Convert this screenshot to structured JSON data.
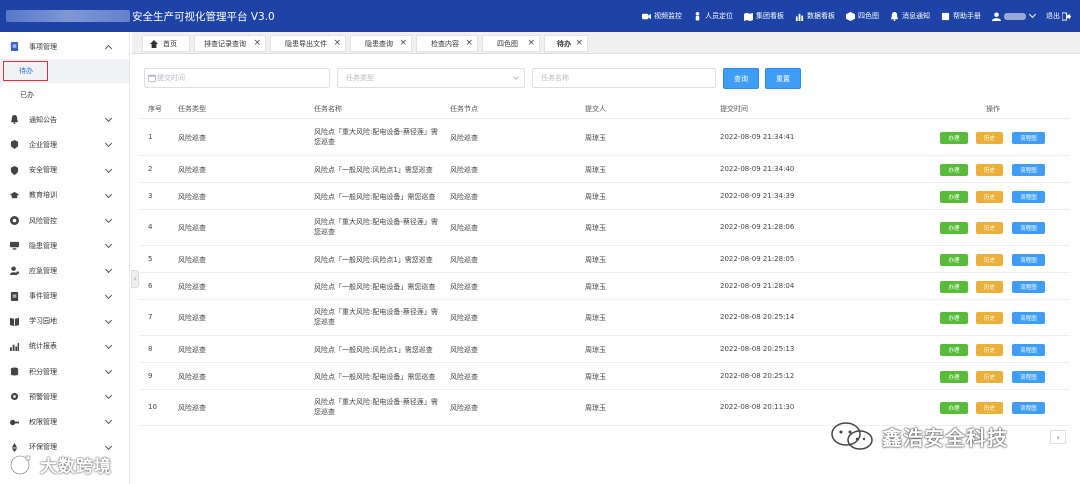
{
  "header": {
    "title": "安全生产可视化管理平台  V3.0",
    "menu": [
      {
        "label": "视频监控",
        "icon": "video-icon"
      },
      {
        "label": "人员定位",
        "icon": "person-pin-icon"
      },
      {
        "label": "集团看板",
        "icon": "map-icon"
      },
      {
        "label": "数据看板",
        "icon": "bar-chart-icon"
      },
      {
        "label": "四色图",
        "icon": "cube-icon"
      },
      {
        "label": "消息通知",
        "icon": "bell-icon"
      },
      {
        "label": "帮助手册",
        "icon": "book-icon"
      }
    ],
    "logout": "退出"
  },
  "sidebar": {
    "groups": [
      {
        "label": "事项管理",
        "icon": "task-icon",
        "expanded": true,
        "children": [
          {
            "label": "待办",
            "active": true
          },
          {
            "label": "已办",
            "active": false
          }
        ]
      },
      {
        "label": "通知公告",
        "icon": "bell-icon"
      },
      {
        "label": "企业管理",
        "icon": "enterprise-icon"
      },
      {
        "label": "安全管理",
        "icon": "shield-icon"
      },
      {
        "label": "教育培训",
        "icon": "graduation-cap-icon"
      },
      {
        "label": "风险管控",
        "icon": "risk-icon"
      },
      {
        "label": "隐患管理",
        "icon": "monitor-icon"
      },
      {
        "label": "应急管理",
        "icon": "user-alert-icon"
      },
      {
        "label": "事件管理",
        "icon": "document-icon"
      },
      {
        "label": "学习园地",
        "icon": "book-open-icon"
      },
      {
        "label": "统计报表",
        "icon": "stats-icon"
      },
      {
        "label": "积分管理",
        "icon": "database-icon"
      },
      {
        "label": "预警管理",
        "icon": "gear-icon"
      },
      {
        "label": "权限管理",
        "icon": "key-icon"
      },
      {
        "label": "环保管理",
        "icon": "recycle-icon"
      }
    ]
  },
  "tabs": [
    {
      "label": "首页",
      "closable": false,
      "home": true
    },
    {
      "label": "排查记录查询",
      "closable": true
    },
    {
      "label": "隐患导出文件",
      "closable": true
    },
    {
      "label": "隐患查询",
      "closable": true
    },
    {
      "label": "检查内容",
      "closable": true
    },
    {
      "label": "四色图",
      "closable": true
    },
    {
      "label": "待办",
      "closable": true,
      "active": true
    }
  ],
  "filters": {
    "submit_time_placeholder": "提交时间",
    "task_type_placeholder": "任务类型",
    "task_name_placeholder": "任务名称",
    "query_label": "查询",
    "reset_label": "重置"
  },
  "table": {
    "columns": [
      "序号",
      "任务类型",
      "任务名称",
      "任务节点",
      "提交人",
      "提交时间",
      "操作"
    ],
    "action_labels": {
      "handle": "办理",
      "history": "历史",
      "flow": "流程图"
    },
    "rows": [
      {
        "no": "1",
        "type": "风险巡查",
        "name": "风险点「重大风险:配电设备-蔡径莲」需您巡查",
        "node": "风险巡查",
        "submitter": "周琼玉",
        "time": "2022-08-09 21:34:41"
      },
      {
        "no": "2",
        "type": "风险巡查",
        "name": "风险点「一般风险:风险点1」需您巡查",
        "node": "风险巡查",
        "submitter": "周琼玉",
        "time": "2022-08-09 21:34:40"
      },
      {
        "no": "3",
        "type": "风险巡查",
        "name": "风险点「一般风险:配电设备」需您巡查",
        "node": "风险巡查",
        "submitter": "周琼玉",
        "time": "2022-08-09 21:34:39"
      },
      {
        "no": "4",
        "type": "风险巡查",
        "name": "风险点「重大风险:配电设备-蔡径莲」需您巡查",
        "node": "风险巡查",
        "submitter": "周琼玉",
        "time": "2022-08-09 21:28:06"
      },
      {
        "no": "5",
        "type": "风险巡查",
        "name": "风险点「一般风险:风险点1」需您巡查",
        "node": "风险巡查",
        "submitter": "周琼玉",
        "time": "2022-08-09 21:28:05"
      },
      {
        "no": "6",
        "type": "风险巡查",
        "name": "风险点「一般风险:配电设备」需您巡查",
        "node": "风险巡查",
        "submitter": "周琼玉",
        "time": "2022-08-09 21:28:04"
      },
      {
        "no": "7",
        "type": "风险巡查",
        "name": "风险点「重大风险:配电设备-蔡径莲」需您巡查",
        "node": "风险巡查",
        "submitter": "周琼玉",
        "time": "2022-08-08 20:25:14"
      },
      {
        "no": "8",
        "type": "风险巡查",
        "name": "风险点「一般风险:风险点1」需您巡查",
        "node": "风险巡查",
        "submitter": "周琼玉",
        "time": "2022-08-08 20:25:13"
      },
      {
        "no": "9",
        "type": "风险巡查",
        "name": "风险点「一般风险:配电设备」需您巡查",
        "node": "风险巡查",
        "submitter": "周琼玉",
        "time": "2022-08-08 20:25:12"
      },
      {
        "no": "10",
        "type": "风险巡查",
        "name": "风险点「重大风险:配电设备-蔡径莲」需您巡查",
        "node": "风险巡查",
        "submitter": "周琼玉",
        "time": "2022-08-08 20:11:30"
      }
    ]
  },
  "watermarks": {
    "left": "大数跨境",
    "right": "鑫浩安全科技"
  },
  "pager": {
    "next": "›"
  },
  "colors": {
    "header_bg": "#1e43a6",
    "handle_button": "#58bc3a",
    "history_button": "#ebb03a",
    "flow_button": "#3f9df5",
    "highlight_box": "#e0323c"
  }
}
